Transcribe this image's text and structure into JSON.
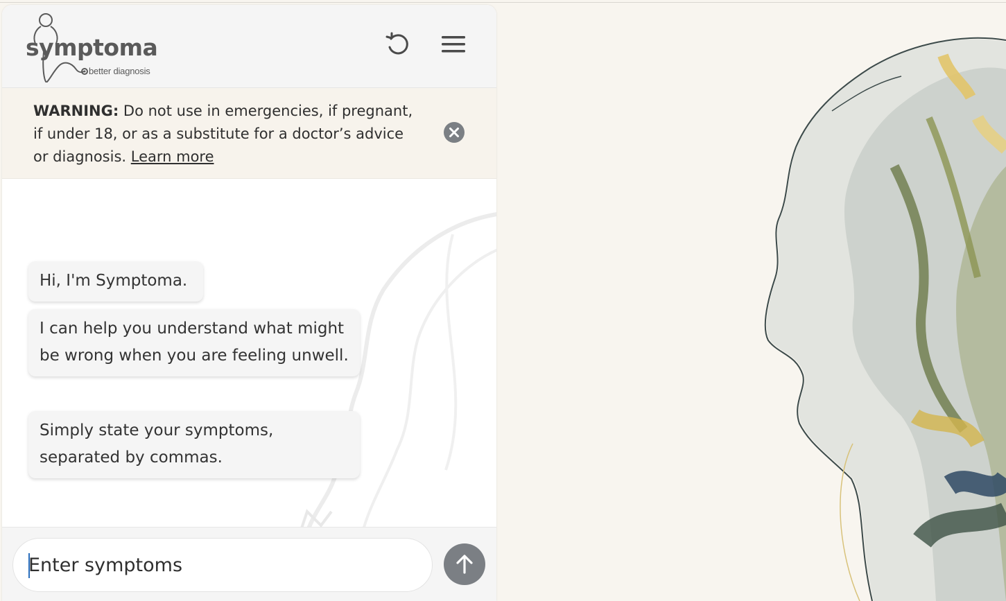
{
  "logo": {
    "wordmark": "symptoma",
    "tagline": "better diagnosis",
    "icon": "stethoscope-figure-icon"
  },
  "header": {
    "reset_icon": "restart-icon",
    "menu_icon": "hamburger-menu-icon"
  },
  "warning": {
    "label": "WARNING:",
    "text": " Do not use in emergencies, if pregnant, if under 18, or as a substitute for a doctor’s advice or diagnosis. ",
    "link": "Learn more",
    "close_icon": "close-circle-icon"
  },
  "chat": {
    "messages": [
      "Hi, I'm Symptoma.",
      "I can help you understand what might be wrong when you are feeling unwell.",
      "Simply state your symptoms, separated by commas."
    ]
  },
  "input": {
    "placeholder": "Enter symptoms",
    "value": "",
    "send_icon": "arrow-up-icon"
  },
  "colors": {
    "page_background": "#f8f5ef",
    "panel_header": "#f5f5f5",
    "warning_background": "#f7f3ec",
    "send_button": "#7b7f84",
    "text": "#2f2f2f"
  }
}
